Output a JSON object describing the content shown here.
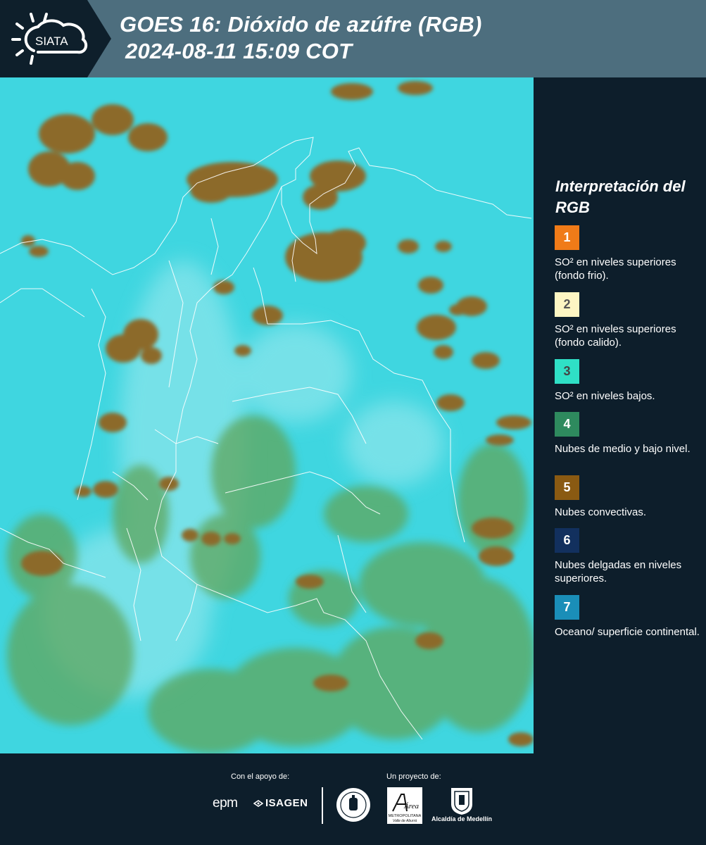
{
  "header": {
    "logo_text": "SIATA",
    "title_line1": "GOES 16: Dióxido de azúfre (RGB)",
    "title_line2": "2024-08-11 15:09 COT"
  },
  "map": {
    "background_color": "#3fd2df",
    "cloud_color": "#8a6a2a",
    "low_cloud_color": "#5da25a",
    "border_color": "#ffffff"
  },
  "legend": {
    "title": "Interpretación del RGB",
    "items": [
      {
        "number": "1",
        "color": "#f07b18",
        "text_color": "#ffffff",
        "label": "SO² en niveles superiores (fondo frio)."
      },
      {
        "number": "2",
        "color": "#fdf6c3",
        "text_color": "#555555",
        "label": "SO² en niveles superiores (fondo calido)."
      },
      {
        "number": "3",
        "color": "#2fe0c6",
        "text_color": "#444444",
        "label": "SO² en niveles bajos."
      },
      {
        "number": "4",
        "color": "#2e8a5e",
        "text_color": "#ffffff",
        "label": "Nubes de medio y bajo nivel."
      },
      {
        "number": "5",
        "color": "#8a5a12",
        "text_color": "#ffffff",
        "label": "Nubes convectivas."
      },
      {
        "number": "6",
        "color": "#12305e",
        "text_color": "#ffffff",
        "label": "Nubes delgadas en niveles superiores."
      },
      {
        "number": "7",
        "color": "#1a8eb8",
        "text_color": "#ffffff",
        "label": "Oceano/ superficie continental."
      }
    ]
  },
  "footer": {
    "support_label": "Con el apoyo de:",
    "project_label": "Un proyecto de:",
    "epm": "epm",
    "isagen": "ISAGEN",
    "area_text": "Área",
    "area_subtext": "METROPOLITANA",
    "area_subtext2": "Valle de Aburrá",
    "alcaldia": "Alcaldía de Medellín"
  }
}
